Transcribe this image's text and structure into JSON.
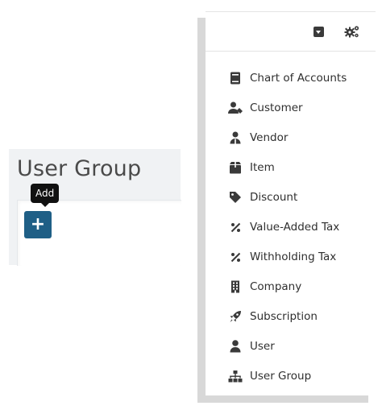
{
  "left": {
    "title": "User Group",
    "add_button_label": "+",
    "tooltip": "Add"
  },
  "menu": {
    "items": [
      {
        "label": "Chart of Accounts",
        "icon": "book-icon"
      },
      {
        "label": "Customer",
        "icon": "customer-icon"
      },
      {
        "label": "Vendor",
        "icon": "vendor-icon"
      },
      {
        "label": "Item",
        "icon": "box-icon"
      },
      {
        "label": "Discount",
        "icon": "tag-icon"
      },
      {
        "label": "Value-Added Tax",
        "icon": "percent-icon"
      },
      {
        "label": "Withholding Tax",
        "icon": "percent-icon"
      },
      {
        "label": "Company",
        "icon": "building-icon"
      },
      {
        "label": "Subscription",
        "icon": "rocket-icon"
      },
      {
        "label": "User",
        "icon": "user-icon"
      },
      {
        "label": "User Group",
        "icon": "sitemap-icon"
      }
    ]
  },
  "colors": {
    "primary_button": "#1f5f86",
    "tooltip_bg": "#111111",
    "icon_color": "#3a3a3a"
  }
}
